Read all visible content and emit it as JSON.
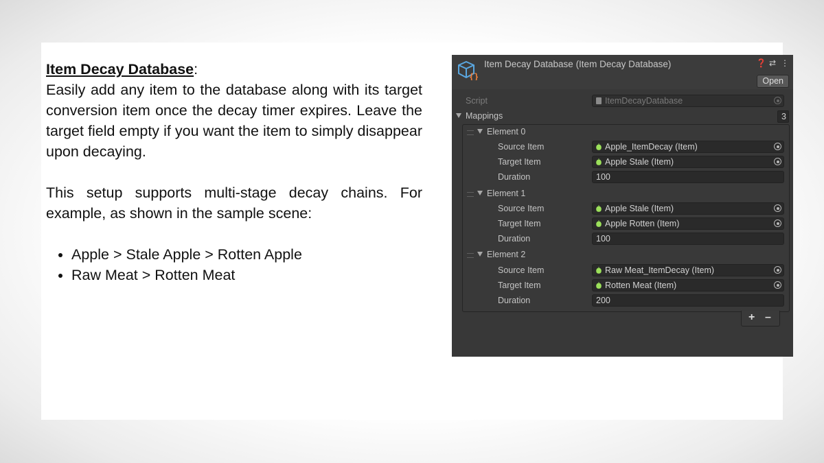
{
  "left_text": {
    "heading": "Item Decay Database",
    "heading_suffix": ":",
    "paragraph1": "Easily add any item to the database along with its target conversion item once the decay timer expires. Leave the target field empty if you want the item to simply disappear upon decaying.",
    "paragraph2": "This setup supports multi-stage decay chains. For example, as shown in the sample scene:",
    "bullets": [
      "Apple > Stale Apple > Rotten Apple",
      "Raw Meat > Rotten Meat"
    ]
  },
  "inspector": {
    "title": "Item Decay Database (Item Decay Database)",
    "header_icons": [
      "help-icon",
      "settings-sliders-icon",
      "more-vert-icon"
    ],
    "open_label": "Open",
    "script_label": "Script",
    "script_value": "ItemDecayDatabase",
    "mappings_label": "Mappings",
    "mappings_count": "3",
    "elements": [
      {
        "label": "Element 0",
        "source_label": "Source Item",
        "source": "Apple_ItemDecay (Item)",
        "target_label": "Target Item",
        "target": "Apple Stale (Item)",
        "duration_label": "Duration",
        "duration": "100"
      },
      {
        "label": "Element 1",
        "source_label": "Source Item",
        "source": "Apple Stale (Item)",
        "target_label": "Target Item",
        "target": "Apple Rotten (Item)",
        "duration_label": "Duration",
        "duration": "100"
      },
      {
        "label": "Element 2",
        "source_label": "Source Item",
        "source": "Raw Meat_ItemDecay (Item)",
        "target_label": "Target Item",
        "target": "Rotten Meat (Item)",
        "duration_label": "Duration",
        "duration": "200"
      }
    ],
    "add_label": "+",
    "remove_label": "–",
    "colors": {
      "panel_bg": "#383838",
      "field_bg": "#2a2a2a",
      "item_icon": "#9be05a",
      "asset_icon_blue": "#5aa7e0",
      "asset_icon_orange": "#f0803c"
    }
  }
}
